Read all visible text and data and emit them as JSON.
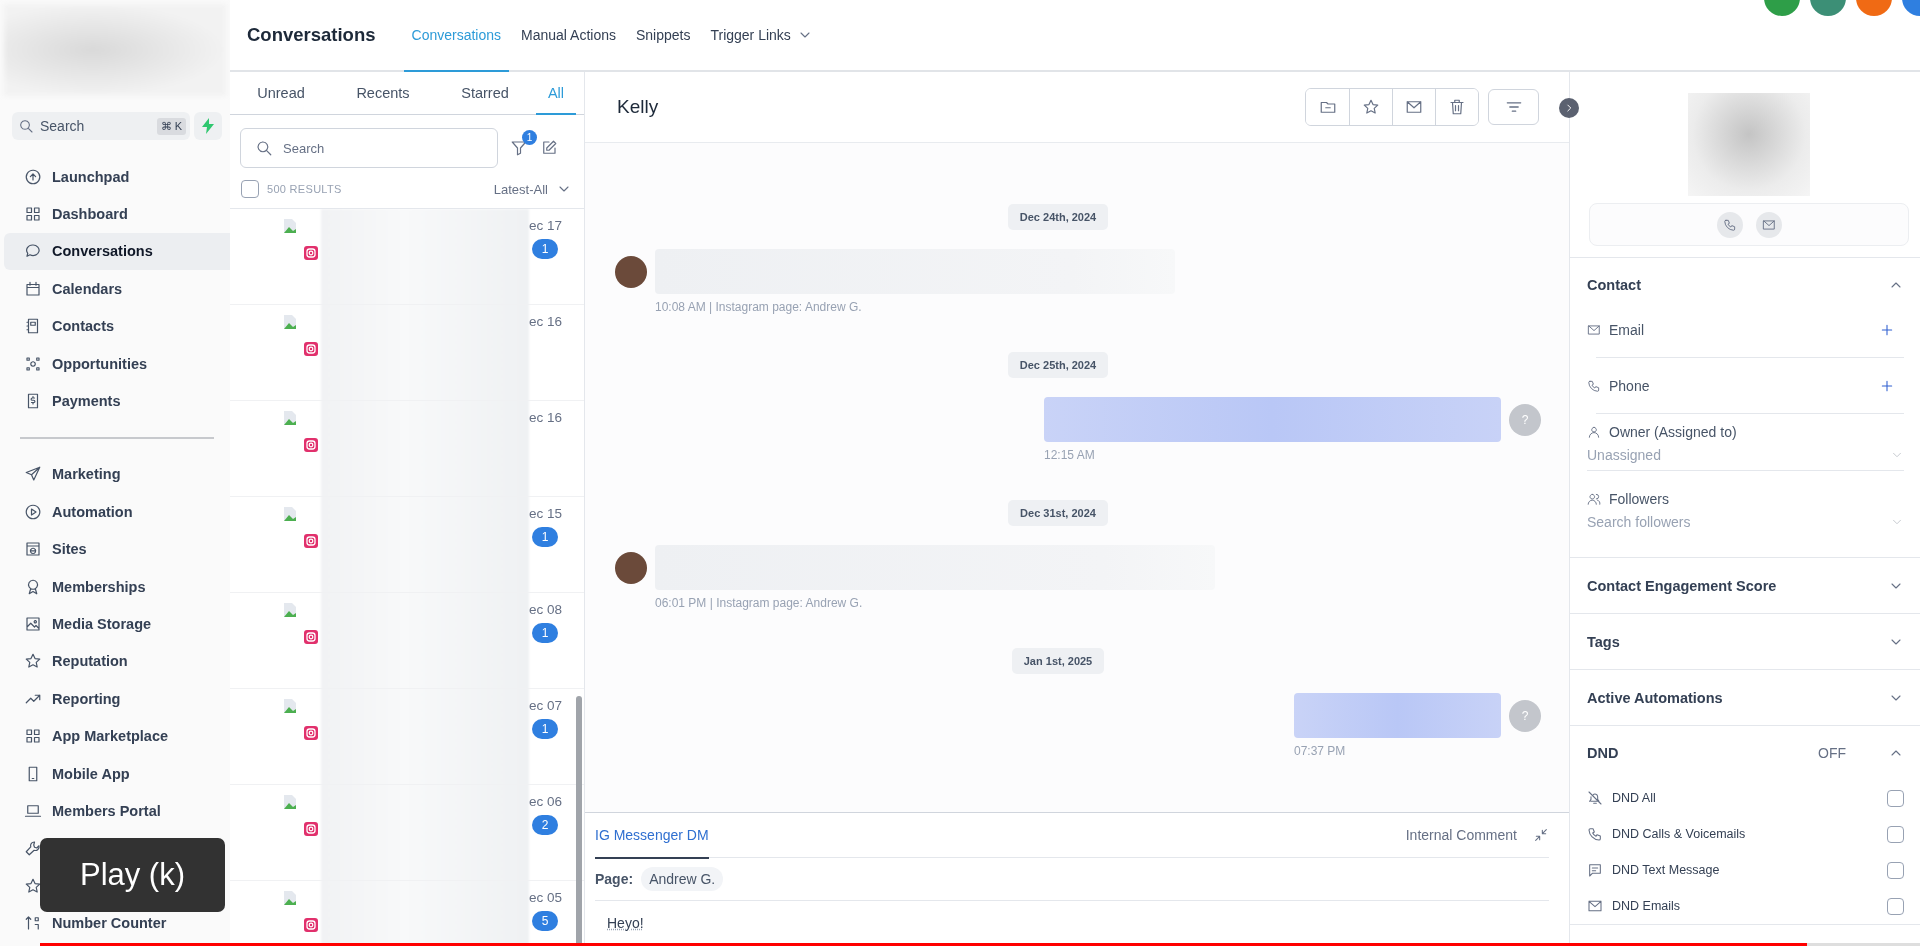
{
  "sidebar": {
    "search": {
      "placeholder": "Search",
      "shortcut": "⌘ K"
    },
    "sections": [
      {
        "items": [
          {
            "label": "Launchpad",
            "selected": false
          },
          {
            "label": "Dashboard",
            "selected": false
          },
          {
            "label": "Conversations",
            "selected": true
          },
          {
            "label": "Calendars",
            "selected": false
          },
          {
            "label": "Contacts",
            "selected": false
          },
          {
            "label": "Opportunities",
            "selected": false
          },
          {
            "label": "Payments",
            "selected": false
          }
        ]
      },
      {
        "items": [
          {
            "label": "Marketing",
            "selected": false
          },
          {
            "label": "Automation",
            "selected": false
          },
          {
            "label": "Sites",
            "selected": false
          },
          {
            "label": "Memberships",
            "selected": false
          },
          {
            "label": "Media Storage",
            "selected": false
          },
          {
            "label": "Reputation",
            "selected": false
          },
          {
            "label": "Reporting",
            "selected": false
          },
          {
            "label": "App Marketplace",
            "selected": false
          },
          {
            "label": "Mobile App",
            "selected": false
          },
          {
            "label": "Members Portal",
            "selected": false
          },
          {
            "selected": false
          },
          {
            "selected": false
          },
          {
            "label": "Number Counter",
            "selected": false
          }
        ]
      }
    ]
  },
  "header": {
    "title": "Conversations",
    "tabs": [
      {
        "label": "Conversations",
        "selected": true
      },
      {
        "label": "Manual Actions",
        "selected": false
      },
      {
        "label": "Snippets",
        "selected": false
      },
      {
        "label": "Trigger Links",
        "selected": false,
        "dropdown": true
      }
    ],
    "buttons": [
      {
        "color": "#2e9e48"
      },
      {
        "color": "#3c8f76"
      },
      {
        "color": "#f06a14"
      },
      {
        "color": "#2f7fe0"
      }
    ]
  },
  "conversation_list": {
    "tabs": [
      {
        "label": "Unread",
        "selected": false
      },
      {
        "label": "Recents",
        "selected": false
      },
      {
        "label": "Starred",
        "selected": false
      },
      {
        "label": "All",
        "selected": true
      }
    ],
    "search": {
      "placeholder": "Search"
    },
    "filter_badge": "1",
    "select_all": {
      "checked": false
    },
    "results": "500 RESULTS",
    "sort": "Latest-All",
    "rows": [
      {
        "date": "ec 17",
        "unread": "1"
      },
      {
        "date": "ec 16"
      },
      {
        "date": "ec 16"
      },
      {
        "date": "ec 15",
        "unread": "1"
      },
      {
        "date": "ec 08",
        "unread": "1"
      },
      {
        "date": "ec 07",
        "unread": "1"
      },
      {
        "date": "ec 06",
        "unread": "2"
      },
      {
        "date": "ec 05",
        "unread": "5"
      }
    ]
  },
  "chat": {
    "contact": "Kelly",
    "messages": [
      {
        "kind": "date",
        "text": "Dec 24th, 2024"
      },
      {
        "kind": "incoming",
        "meta": "10:08 AM | Instagram page: Andrew G."
      },
      {
        "kind": "date",
        "text": "Dec 25th, 2024"
      },
      {
        "kind": "outgoing",
        "meta": "12:15 AM",
        "avatar": "?"
      },
      {
        "kind": "date",
        "text": "Dec 31st, 2024"
      },
      {
        "kind": "incoming",
        "meta": "06:01 PM | Instagram page: Andrew G."
      },
      {
        "kind": "date",
        "text": "Jan 1st, 2025"
      },
      {
        "kind": "outgoing",
        "meta": "07:37 PM",
        "avatar": "?"
      }
    ]
  },
  "composer": {
    "tabs": [
      {
        "label": "IG Messenger DM",
        "selected": true
      },
      {
        "label": "Internal Comment",
        "selected": false
      }
    ],
    "page_label": "Page:",
    "page": "Andrew G.",
    "value": "Heyo!"
  },
  "contact_panel": {
    "contact": {
      "title": "Contact",
      "expanded": true,
      "fields": [
        {
          "kind": "add",
          "label": "Email"
        },
        {
          "kind": "add",
          "label": "Phone"
        },
        {
          "kind": "select",
          "label": "Owner (Assigned to)",
          "placeholder": "Unassigned"
        },
        {
          "kind": "select",
          "label": "Followers",
          "placeholder": "Search followers"
        }
      ]
    },
    "sections": [
      {
        "title": "Contact Engagement Score",
        "expanded": false
      },
      {
        "title": "Tags",
        "expanded": false
      },
      {
        "title": "Active Automations",
        "expanded": false
      }
    ],
    "dnd": {
      "title": "DND",
      "status": "OFF",
      "expanded": true,
      "options": [
        {
          "label": "DND All",
          "checked": false
        },
        {
          "label": "DND Calls & Voicemails",
          "checked": false
        },
        {
          "label": "DND Text Message",
          "checked": false
        },
        {
          "label": "DND Emails",
          "checked": false
        }
      ]
    }
  },
  "video_player": {
    "tooltip": "Play (k)",
    "progress": {
      "level": 0.94
    }
  }
}
